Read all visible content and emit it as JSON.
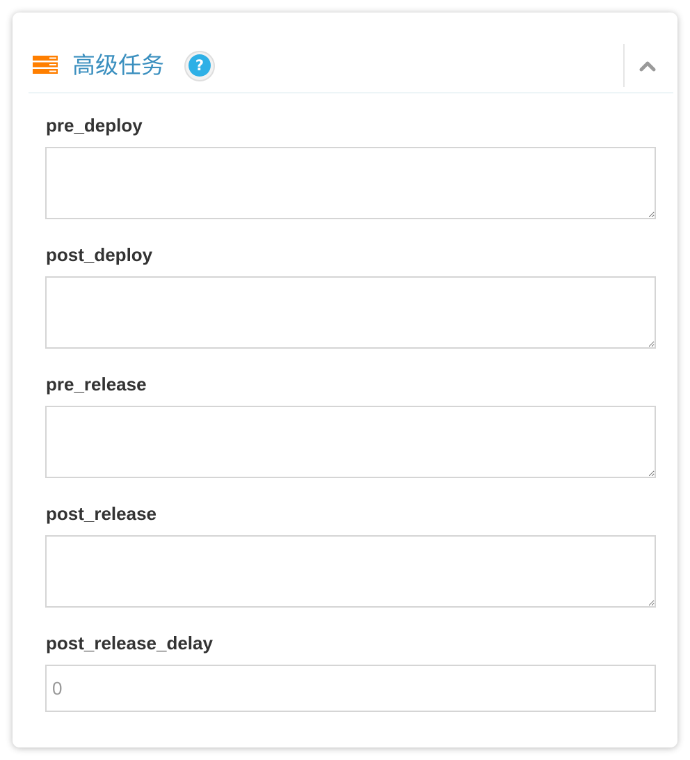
{
  "panel": {
    "title": "高级任务",
    "help_label": "?",
    "collapse_icon": "chevron-up-icon",
    "header_icon": "server-stack-icon",
    "colors": {
      "title": "#3a8fbf",
      "header_icon": "#ff7f00",
      "help_badge": "#2eb0e6"
    }
  },
  "fields": {
    "pre_deploy": {
      "label": "pre_deploy",
      "value": ""
    },
    "post_deploy": {
      "label": "post_deploy",
      "value": ""
    },
    "pre_release": {
      "label": "pre_release",
      "value": ""
    },
    "post_release": {
      "label": "post_release",
      "value": ""
    },
    "post_release_delay": {
      "label": "post_release_delay",
      "value": "",
      "placeholder": "0"
    }
  }
}
